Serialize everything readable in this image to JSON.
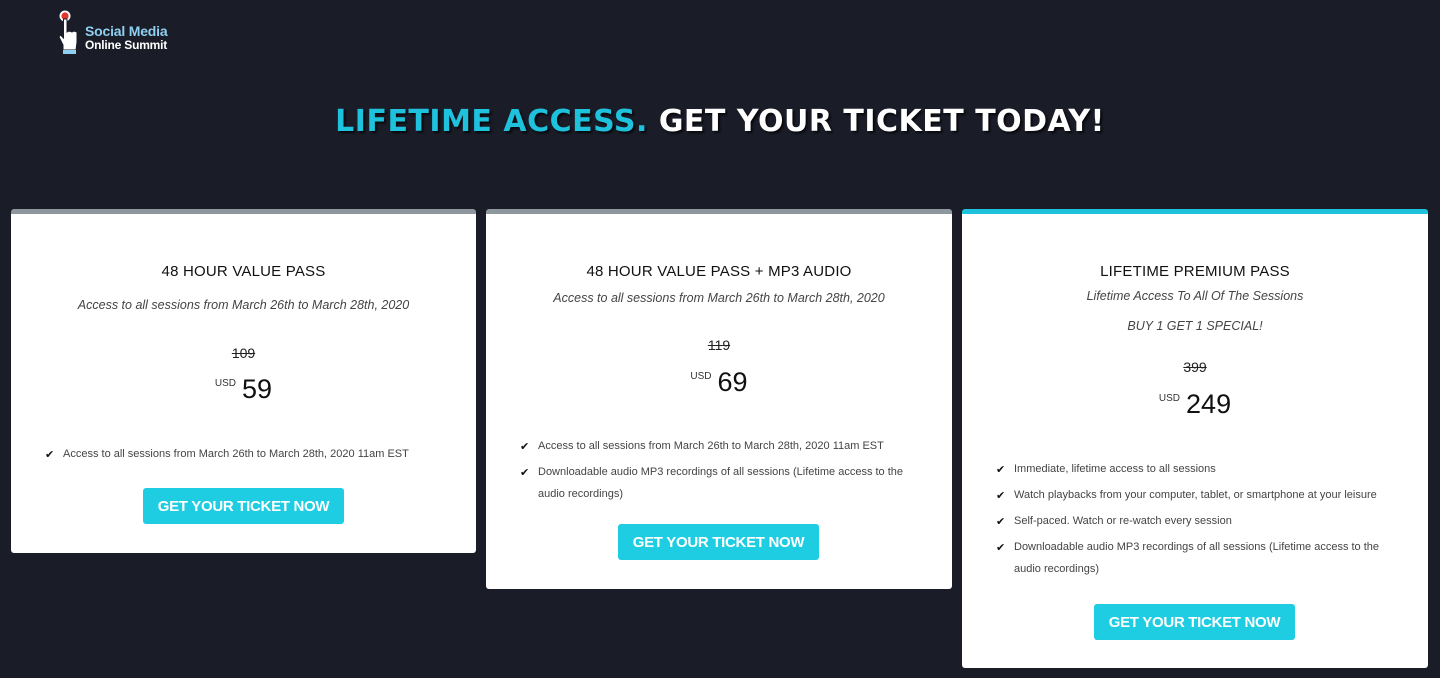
{
  "brand": {
    "line1": "Social Media",
    "line2": "Online Summit"
  },
  "headline": {
    "accent": "LIFETIME ACCESS.",
    "main": "GET YOUR TICKET TODAY!"
  },
  "colors": {
    "background": "#1a1c28",
    "accent": "#1fc2dd",
    "button": "#1fcde3",
    "card_top_default": "#8e969e"
  },
  "plans": [
    {
      "title": "48 HOUR VALUE PASS",
      "subtitle": "Access to all sessions from March 26th to March 28th, 2020",
      "old_price": "109",
      "currency": "USD",
      "price": "59",
      "features": [
        "Access to all sessions from March 26th to March 28th, 2020 11am EST"
      ],
      "cta": "GET YOUR TICKET NOW"
    },
    {
      "title": "48 HOUR VALUE PASS + MP3 AUDIO",
      "subtitle": "Access to all sessions from March 26th to March 28th, 2020",
      "old_price": "119",
      "currency": "USD",
      "price": "69",
      "features": [
        "Access to all sessions from March 26th to March 28th, 2020 11am EST",
        "Downloadable audio MP3 recordings of all sessions (Lifetime access to the audio recordings)"
      ],
      "cta": "GET YOUR TICKET NOW"
    },
    {
      "title": "LIFETIME PREMIUM PASS",
      "subtitle": "Lifetime Access To All Of The Sessions",
      "special": "BUY 1 GET 1 SPECIAL!",
      "old_price": "399",
      "currency": "USD",
      "price": "249",
      "features": [
        "Immediate, lifetime access to all sessions",
        "Watch playbacks from your computer, tablet, or smartphone at your leisure",
        "Self-paced. Watch or re-watch every session",
        "Downloadable audio MP3 recordings of all sessions (Lifetime access to the audio recordings)"
      ],
      "cta": "GET YOUR TICKET NOW"
    }
  ]
}
